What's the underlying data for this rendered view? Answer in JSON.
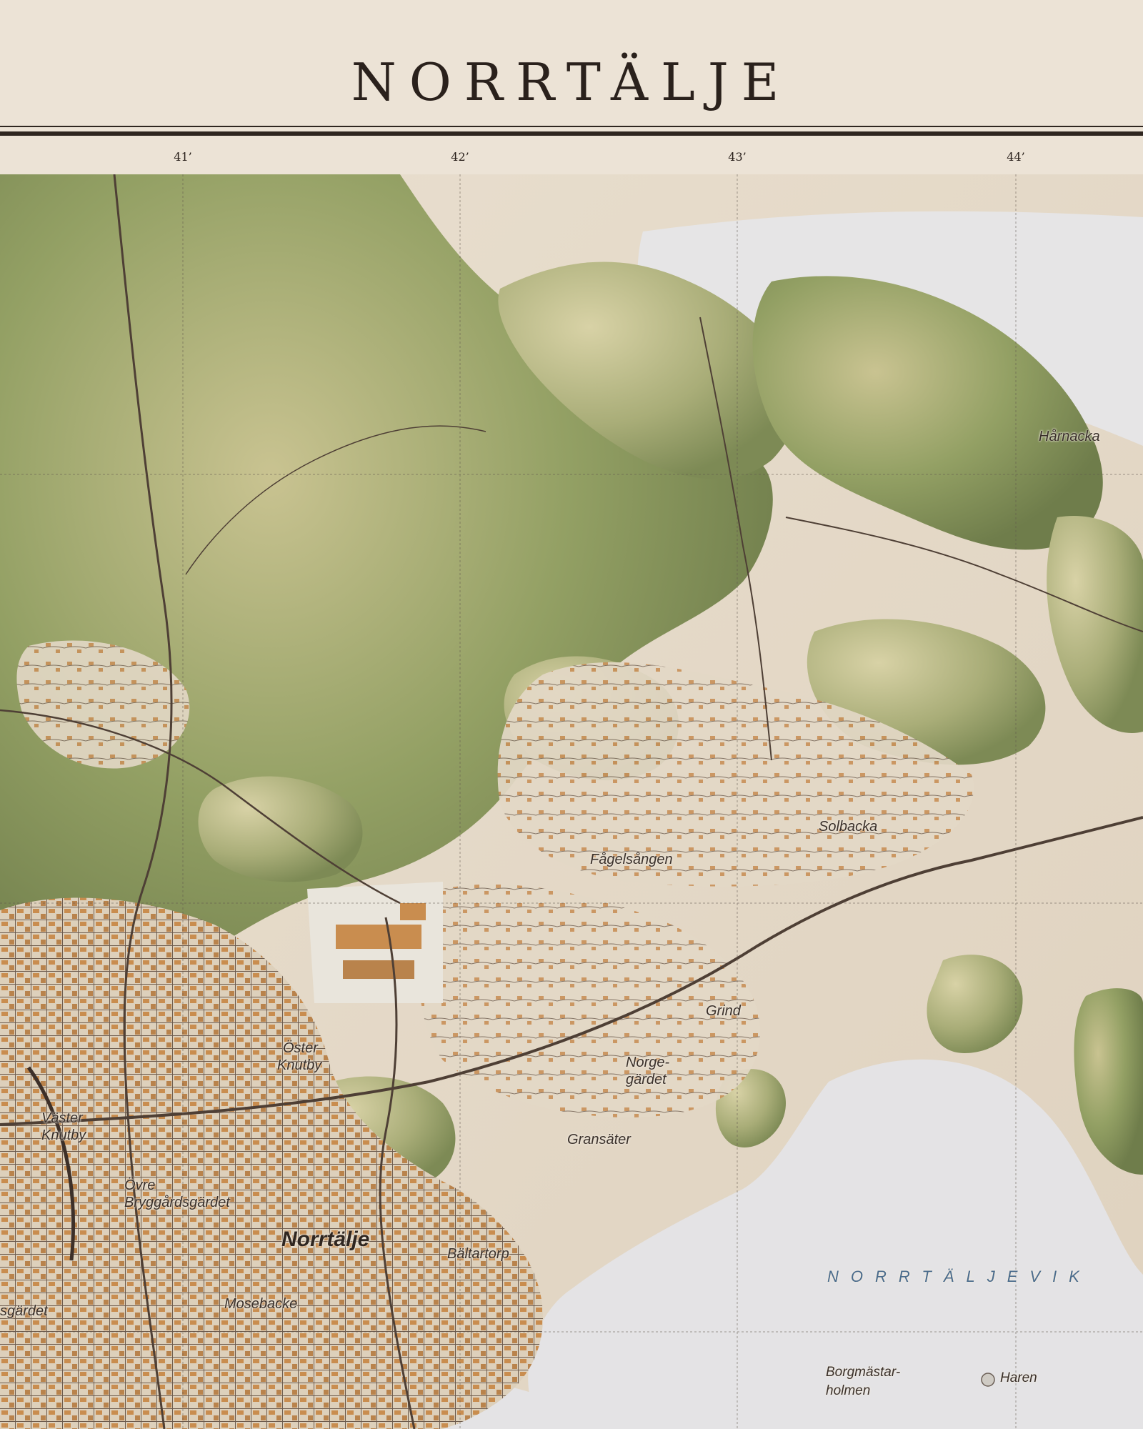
{
  "map": {
    "title": "NORRTÄLJE",
    "longitude_ticks": [
      "41’",
      "42’",
      "43’",
      "44’"
    ],
    "place_labels": {
      "harnacka": "Hårnacka",
      "solbacka": "Solbacka",
      "fagelsangen": "Fågelsången",
      "grind": "Grind",
      "oster_1": "Öster",
      "oster_2": "Knutby",
      "norge_1": "Norge-",
      "norge_2": "gärdet",
      "vaster_1": "Väster",
      "vaster_2": "Knutby",
      "gransater": "Gransäter",
      "ovre_1": "Övre",
      "ovre_2": "Bryggårdsgärdet",
      "norrtalje": "Norrtälje",
      "baltartorp": "Bältartorp",
      "sgardet": "sgärdet",
      "mosebacke": "Mosebacke",
      "borg_1": "Borgmästar-",
      "borg_2": "holmen",
      "haren": "Haren"
    },
    "water_labels": {
      "norrtaljeviken": "NORRTÄLJEVIK"
    },
    "colors": {
      "paper": "#ece3d6",
      "ink": "#2a211c",
      "land": "#e6dccd",
      "forest": "#8e9a62",
      "forest_light": "#b8b585",
      "water": "#e4e4e6",
      "buildings": "#c98d4f",
      "roads": "#5a4a40",
      "water_label": "#4a6b8c"
    }
  }
}
